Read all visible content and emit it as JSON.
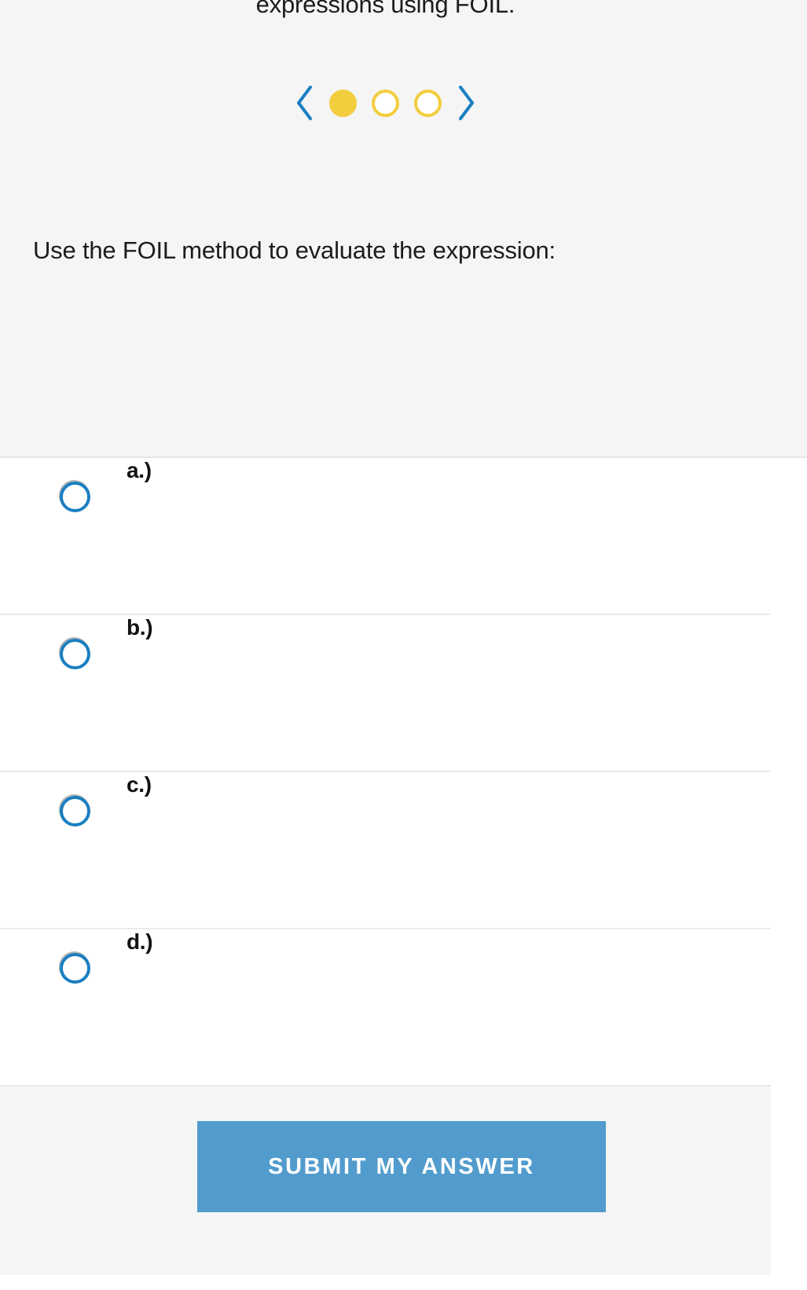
{
  "overflow_text": "expressions using FOIL.",
  "pager": {
    "prev_icon": "chevron-left-icon",
    "next_icon": "chevron-right-icon",
    "dots": [
      {
        "index": 1,
        "active": true
      },
      {
        "index": 2,
        "active": false
      },
      {
        "index": 3,
        "active": false
      }
    ],
    "active_index": 1,
    "total": 3,
    "dot_color": "#f2cd3e",
    "arrow_color": "#1a7fc1"
  },
  "question": {
    "prompt": "Use the FOIL method to evaluate the expression:",
    "expression": ""
  },
  "choices": [
    {
      "label": "a.)",
      "text": "",
      "selected": false
    },
    {
      "label": "b.)",
      "text": "",
      "selected": false
    },
    {
      "label": "c.)",
      "text": "",
      "selected": false
    },
    {
      "label": "d.)",
      "text": "",
      "selected": false
    }
  ],
  "footer": {
    "submit_label": "SUBMIT MY ANSWER",
    "submit_color": "#529ccd"
  },
  "colors": {
    "panel_background": "#f5f5f5",
    "content_background": "#ffffff",
    "divider": "#e9eaee",
    "radio_border": "#1a7fc1",
    "text": "#1c1c1c"
  }
}
